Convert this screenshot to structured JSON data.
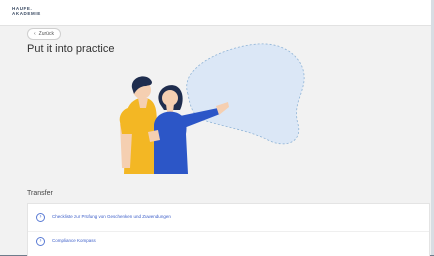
{
  "brand": {
    "logo_line1": "HAUFE.",
    "logo_line2": "AKADEMIE"
  },
  "nav": {
    "back_label": "Zurück"
  },
  "page": {
    "title": "Put it into practice"
  },
  "transfer": {
    "heading": "Transfer",
    "items": [
      {
        "label": "Checkliste zur Prüfung von Geschenken und Zuwendungen",
        "icon": "arrow-circle-icon"
      },
      {
        "label": "Compliance Kompass",
        "icon": "arrow-circle-icon"
      }
    ]
  },
  "colors": {
    "accent": "#3d5fc9",
    "man_shirt": "#f3b724",
    "woman_top": "#2c56c7",
    "hair": "#1f2d4e",
    "cloud": "#dbe7f6"
  }
}
